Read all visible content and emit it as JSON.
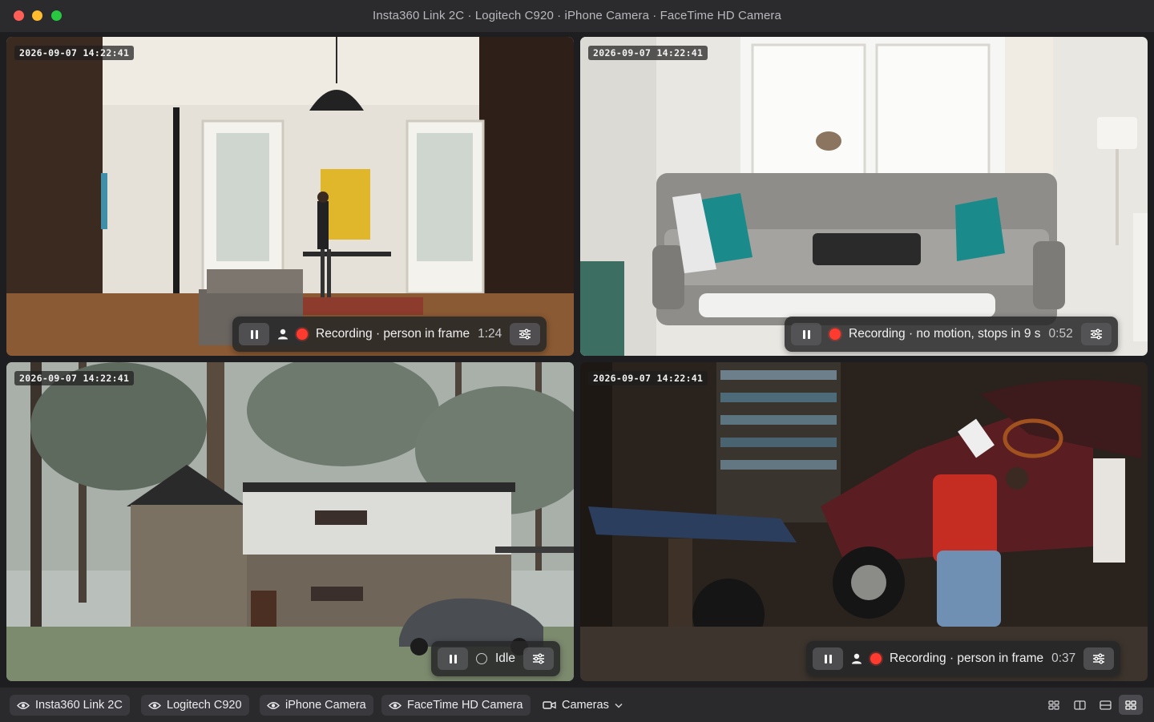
{
  "window": {
    "title": "Insta360 Link 2C · Logitech C920 · iPhone Camera · FaceTime HD Camera"
  },
  "cameras": [
    {
      "name": "Insta360 Link 2C",
      "timestamp": "2026-09-07 14:22:41",
      "status_text": "Recording · person in frame",
      "elapsed": "1:24",
      "state": "recording",
      "person_detected": true
    },
    {
      "name": "Logitech C920",
      "timestamp": "2026-09-07 14:22:41",
      "status_text": "Recording · no motion, stops in 9 s",
      "elapsed": "0:52",
      "state": "recording",
      "person_detected": false
    },
    {
      "name": "iPhone Camera",
      "timestamp": "2026-09-07 14:22:41",
      "status_text": "Idle",
      "elapsed": "",
      "state": "idle",
      "person_detected": false
    },
    {
      "name": "FaceTime HD Camera",
      "timestamp": "2026-09-07 14:22:41",
      "status_text": "Recording · person in frame",
      "elapsed": "0:37",
      "state": "recording",
      "person_detected": true
    }
  ],
  "bottombar": {
    "chips": [
      "Insta360 Link 2C",
      "Logitech C920",
      "iPhone Camera",
      "FaceTime HD Camera"
    ],
    "cameras_menu": "Cameras",
    "layouts": [
      "grid-small",
      "split-vertical",
      "split-horizontal",
      "grid-2x2"
    ],
    "active_layout": "grid-2x2"
  },
  "colors": {
    "record": "#ff3b30",
    "chrome": "#2b2b2e",
    "chip": "#3a3a3e"
  }
}
